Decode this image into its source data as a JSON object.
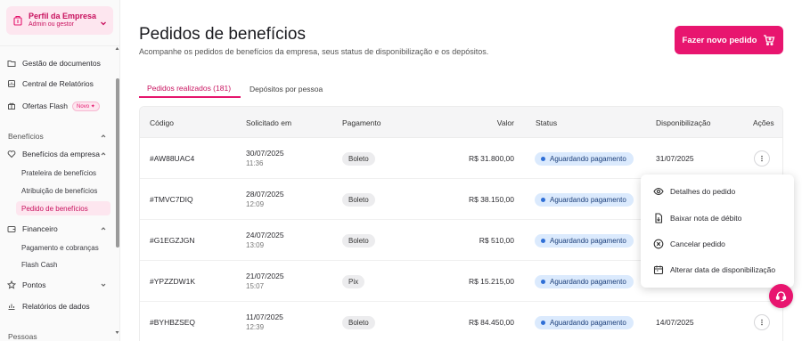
{
  "profile": {
    "name": "Perfil da Empresa",
    "role": "Admin ou gestor"
  },
  "sidebar": {
    "items": [
      {
        "label": "Gestão de documentos",
        "icon": "folder-icon"
      },
      {
        "label": "Central de Relatórios",
        "icon": "report-icon"
      },
      {
        "label": "Ofertas Flash",
        "icon": "gift-icon",
        "badge": "Novo ✦"
      }
    ],
    "section_beneficios": "Benefícios",
    "beneficios_group": {
      "label": "Benefícios da empresa",
      "icon": "heart-icon"
    },
    "beneficios_sub": [
      {
        "label": "Prateleira de benefícios"
      },
      {
        "label": "Atribuição de benefícios"
      },
      {
        "label": "Pedido de benefícios",
        "active": true
      }
    ],
    "financeiro_group": {
      "label": "Financeiro",
      "icon": "wallet-icon"
    },
    "financeiro_sub": [
      {
        "label": "Pagamento e cobranças"
      },
      {
        "label": "Flash Cash"
      }
    ],
    "pontos": {
      "label": "Pontos",
      "icon": "star-icon"
    },
    "relatorios_dados": {
      "label": "Relatórios de dados",
      "icon": "chart-icon"
    },
    "section_pessoas": "Pessoas"
  },
  "header": {
    "title": "Pedidos de benefícios",
    "subtitle": "Acompanhe os pedidos de benefícios da empresa, seus status de disponibilização e os depósitos.",
    "new_order_button": "Fazer novo pedido"
  },
  "tabs": [
    {
      "label": "Pedidos realizados (181)",
      "active": true
    },
    {
      "label": "Depósitos por pessoa",
      "active": false
    }
  ],
  "table": {
    "columns": [
      "Código",
      "Solicitado em",
      "Pagamento",
      "Valor",
      "Status",
      "Disponibilização",
      "Ações"
    ],
    "rows": [
      {
        "code": "#AW88UAC4",
        "date": "30/07/2025",
        "time": "11:36",
        "payment": "Boleto",
        "value": "R$ 31.800,00",
        "status": "Aguardando pagamento",
        "availability": "31/07/2025"
      },
      {
        "code": "#TMVC7DIQ",
        "date": "28/07/2025",
        "time": "12:09",
        "payment": "Boleto",
        "value": "R$ 38.150,00",
        "status": "Aguardando pagamento",
        "availability": ""
      },
      {
        "code": "#G1EGZJGN",
        "date": "24/07/2025",
        "time": "13:09",
        "payment": "Boleto",
        "value": "R$ 510,00",
        "status": "Aguardando pagamento",
        "availability": ""
      },
      {
        "code": "#YPZZDW1K",
        "date": "21/07/2025",
        "time": "15:07",
        "payment": "Pix",
        "value": "R$ 15.215,00",
        "status": "Aguardando pagamento",
        "availability": ""
      },
      {
        "code": "#BYHBZSEQ",
        "date": "11/07/2025",
        "time": "12:39",
        "payment": "Boleto",
        "value": "R$ 84.450,00",
        "status": "Aguardando pagamento",
        "availability": "14/07/2025"
      }
    ]
  },
  "menu": {
    "items": [
      {
        "label": "Detalhes do pedido",
        "icon": "eye-icon"
      },
      {
        "label": "Baixar nota de débito",
        "icon": "file-download-icon"
      },
      {
        "label": "Cancelar pedido",
        "icon": "close-circle-icon"
      },
      {
        "label": "Alterar data de disponibilização",
        "icon": "calendar-icon"
      }
    ]
  },
  "colors": {
    "brand": "#e8156f",
    "brand_light": "#fde6ef",
    "status_bg": "#dbeafd",
    "status_dot": "#2f6fd6"
  }
}
